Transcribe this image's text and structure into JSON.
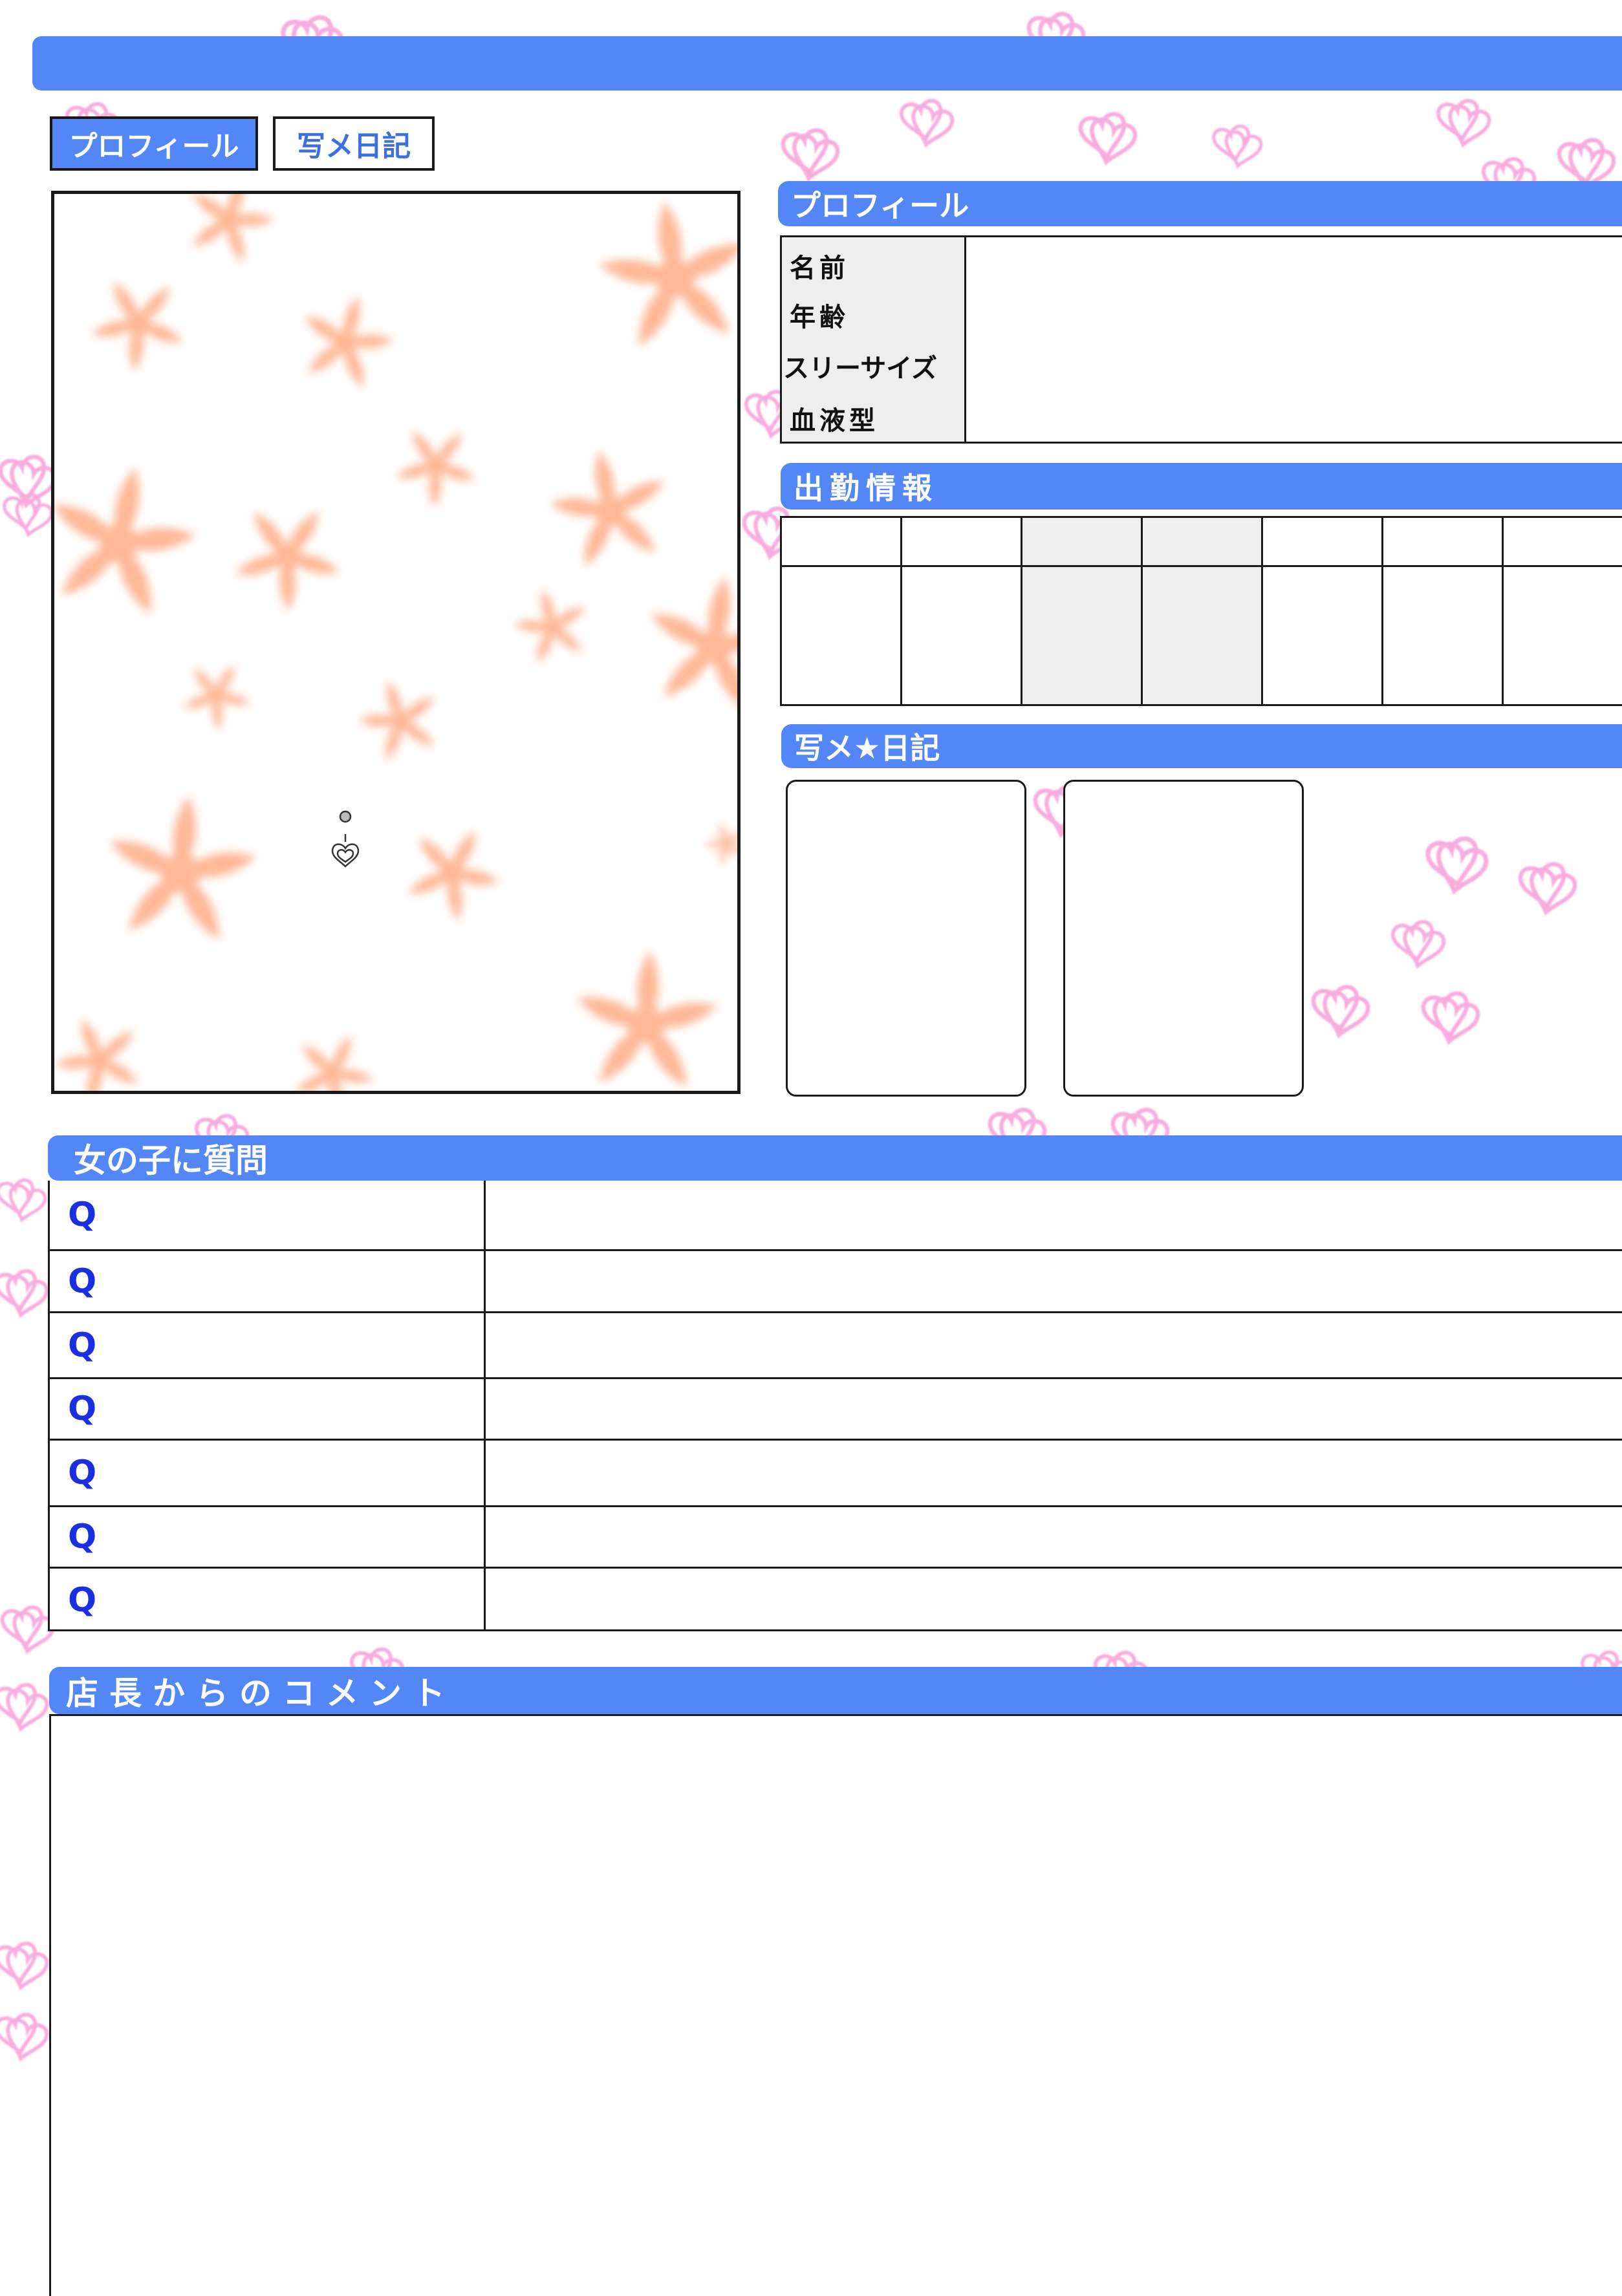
{
  "tabs": [
    {
      "label": "プロフィール",
      "active": true
    },
    {
      "label": "写メ日記",
      "active": false
    }
  ],
  "profile": {
    "title": "プロフィール",
    "fields": [
      {
        "label": "名前",
        "value": ""
      },
      {
        "label": "年齢",
        "value": ""
      },
      {
        "label": "スリーサイズ",
        "value": ""
      },
      {
        "label": "血液型",
        "value": ""
      }
    ]
  },
  "schedule": {
    "title": "出勤情報",
    "days": [
      "",
      "",
      "",
      "",
      "",
      "",
      ""
    ]
  },
  "diary": {
    "title": "写メ★日記"
  },
  "qa": {
    "title": "女の子に質問",
    "rows": [
      {
        "q": "Q",
        "a": ""
      },
      {
        "q": "Q",
        "a": ""
      },
      {
        "q": "Q",
        "a": ""
      },
      {
        "q": "Q",
        "a": ""
      },
      {
        "q": "Q",
        "a": ""
      },
      {
        "q": "Q",
        "a": ""
      },
      {
        "q": "Q",
        "a": ""
      }
    ]
  },
  "comment": {
    "title": "店長からのコメント",
    "text": ""
  },
  "colors": {
    "accent": "#5387f8",
    "question": "#1a2fe0",
    "heart": "#f06bc0",
    "flower": "#ffb897",
    "cell_shade": "#eeeeee"
  },
  "icons": [
    "heart-pattern",
    "flower-pattern",
    "heart-charm-icon"
  ]
}
